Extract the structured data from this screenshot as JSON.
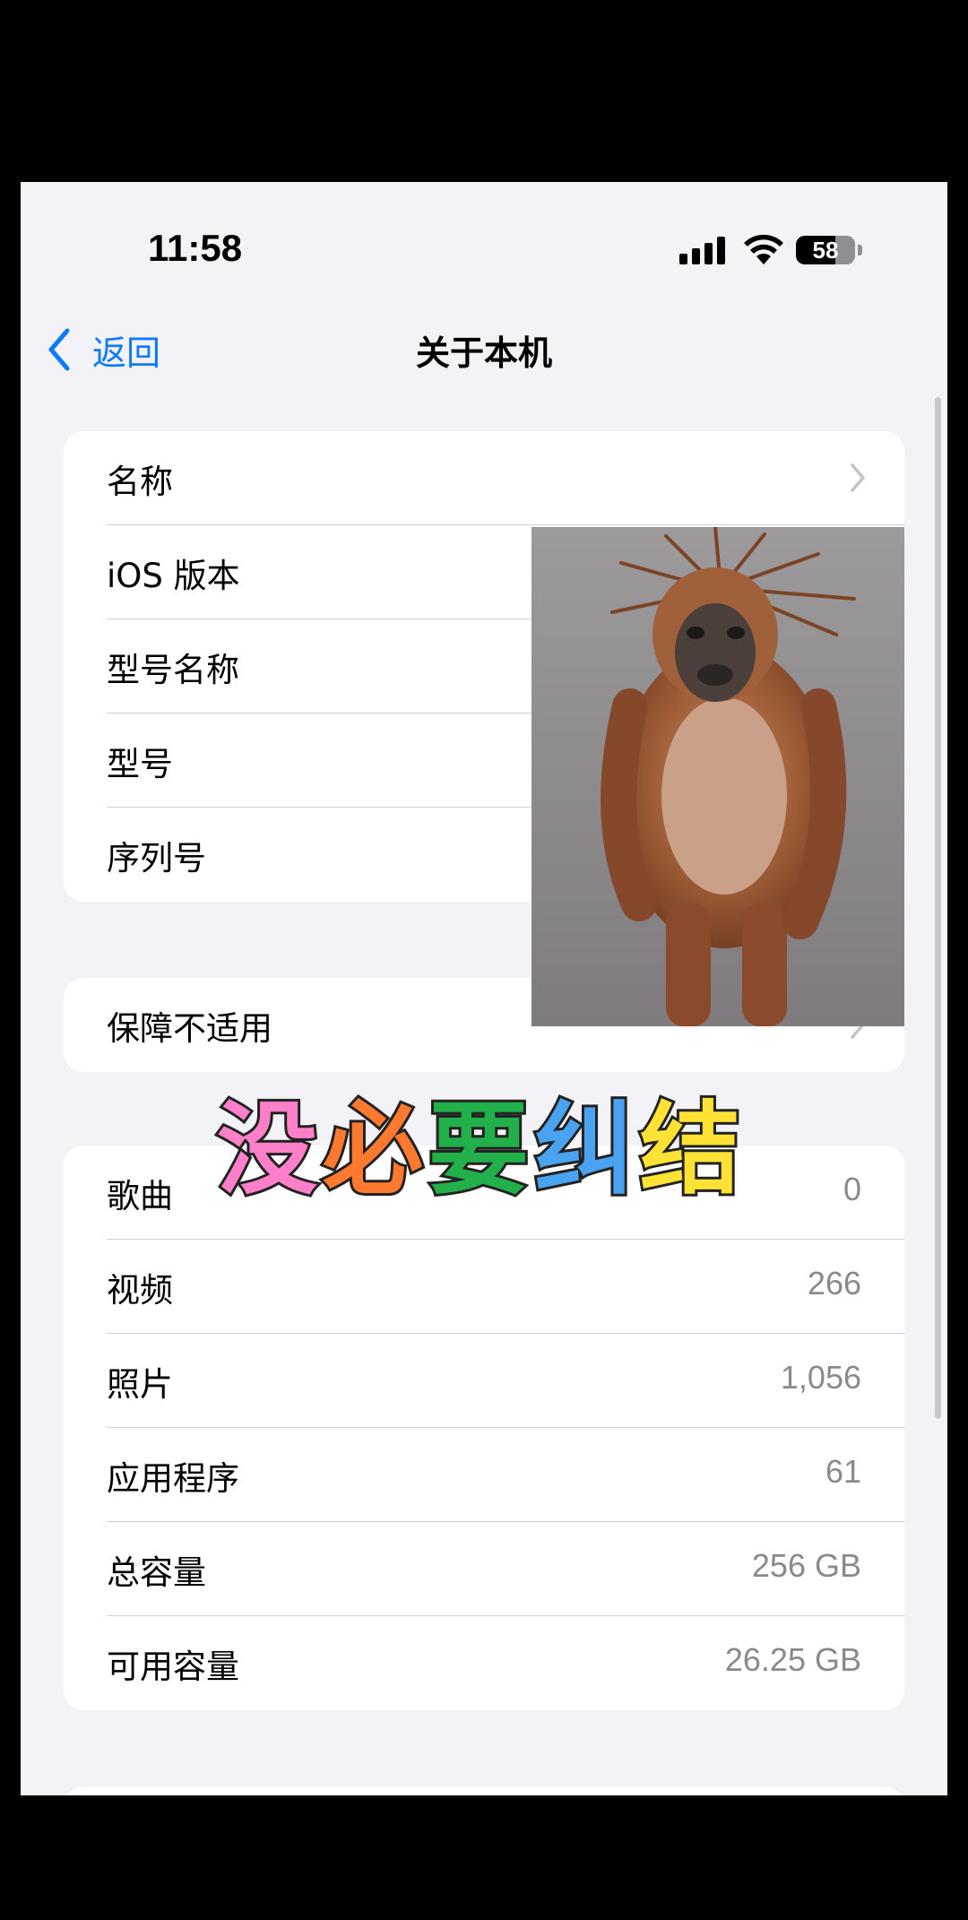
{
  "status_bar": {
    "time": "11:58",
    "battery": "58",
    "signal_icon": "signal-icon",
    "wifi_icon": "wifi-icon"
  },
  "nav": {
    "back_label": "返回",
    "title": "关于本机",
    "back_icon": "chevron-left-icon"
  },
  "group1": {
    "rows": [
      {
        "label": "名称",
        "value": "",
        "chevron": true
      },
      {
        "label": "iOS 版本",
        "value": ""
      },
      {
        "label": "型号名称",
        "value": ""
      },
      {
        "label": "型号",
        "value": ""
      },
      {
        "label": "序列号",
        "value": ""
      }
    ]
  },
  "group2": {
    "rows": [
      {
        "label": "保障不适用",
        "chevron": true
      }
    ]
  },
  "group3": {
    "rows": [
      {
        "label": "歌曲",
        "value": "0"
      },
      {
        "label": "视频",
        "value": "266"
      },
      {
        "label": "照片",
        "value": "1,056"
      },
      {
        "label": "应用程序",
        "value": "61"
      },
      {
        "label": "总容量",
        "value": "256 GB"
      },
      {
        "label": "可用容量",
        "value": "26.25 GB"
      }
    ]
  },
  "overlay": {
    "caption": [
      "没",
      "必",
      "要",
      "纠",
      "结"
    ],
    "caption_colors": [
      "#ff7fc8",
      "#ff7a2f",
      "#22b04a",
      "#4aa3f0",
      "#ffe233"
    ],
    "sticker": "orangutan-meme-image"
  }
}
